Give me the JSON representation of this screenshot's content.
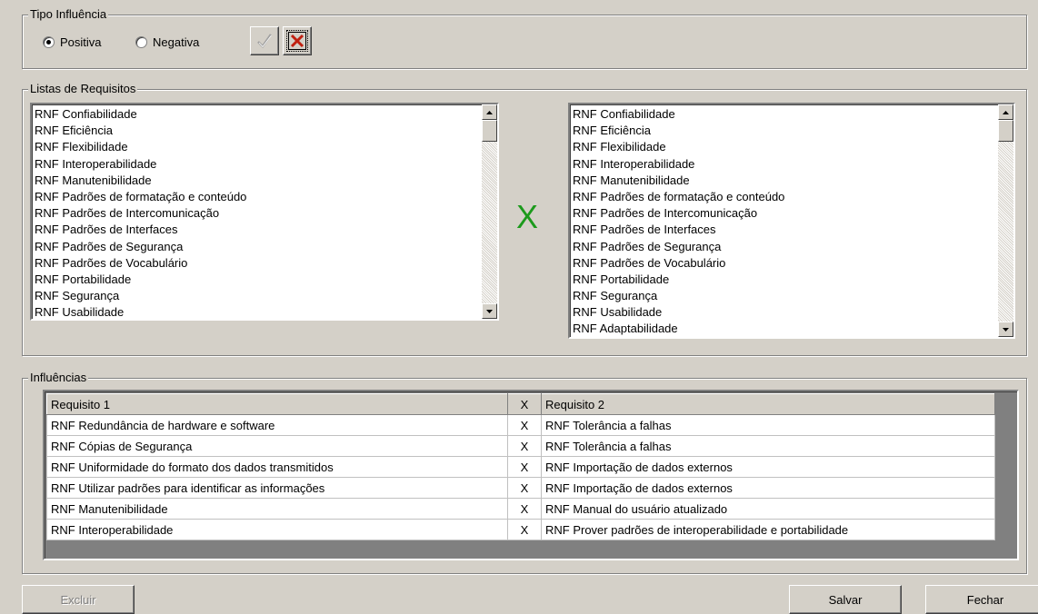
{
  "tipo_influencia": {
    "title": "Tipo Influência",
    "options": [
      {
        "label": "Positiva",
        "selected": true
      },
      {
        "label": "Negativa",
        "selected": false
      }
    ]
  },
  "listas": {
    "title": "Listas de Requisitos",
    "separator": "X",
    "left_items": [
      "RNF Confiabilidade",
      "RNF Eficiência",
      "RNF Flexibilidade",
      "RNF Interoperabilidade",
      "RNF Manutenibilidade",
      "RNF Padrões de formatação e conteúdo",
      "RNF Padrões de Intercomunicação",
      "RNF Padrões de Interfaces",
      "RNF Padrões de Segurança",
      "RNF Padrões de Vocabulário",
      "RNF Portabilidade",
      "RNF Segurança",
      "RNF Usabilidade"
    ],
    "right_items": [
      "RNF Confiabilidade",
      "RNF Eficiência",
      "RNF Flexibilidade",
      "RNF Interoperabilidade",
      "RNF Manutenibilidade",
      "RNF Padrões de formatação e conteúdo",
      "RNF Padrões de Intercomunicação",
      "RNF Padrões de Interfaces",
      "RNF Padrões de Segurança",
      "RNF Padrões de Vocabulário",
      "RNF Portabilidade",
      "RNF Segurança",
      "RNF Usabilidade",
      "RNF Adaptabilidade"
    ]
  },
  "influencias": {
    "title": "Influências",
    "columns": [
      "Requisito 1",
      "X",
      "Requisito 2"
    ],
    "rows": [
      [
        "RNF Redundância de hardware e software",
        "X",
        "RNF Tolerância a falhas"
      ],
      [
        "RNF Cópias de Segurança",
        "X",
        "RNF Tolerância a falhas"
      ],
      [
        "RNF Uniformidade do formato dos dados transmitidos",
        "X",
        "RNF Importação de dados externos"
      ],
      [
        "RNF Utilizar padrões para identificar as informações",
        "X",
        "RNF Importação de dados externos"
      ],
      [
        "RNF Manutenibilidade",
        "X",
        "RNF Manual do usuário atualizado"
      ],
      [
        "RNF Interoperabilidade",
        "X",
        "RNF Prover padrões de interoperabilidade e portabilidade"
      ]
    ]
  },
  "buttons": {
    "excluir": "Excluir",
    "salvar": "Salvar",
    "fechar": "Fechar"
  },
  "colors": {
    "background": "#d4d0c8",
    "accent_green": "#1c9a1c",
    "cancel_red": "#c02010"
  }
}
